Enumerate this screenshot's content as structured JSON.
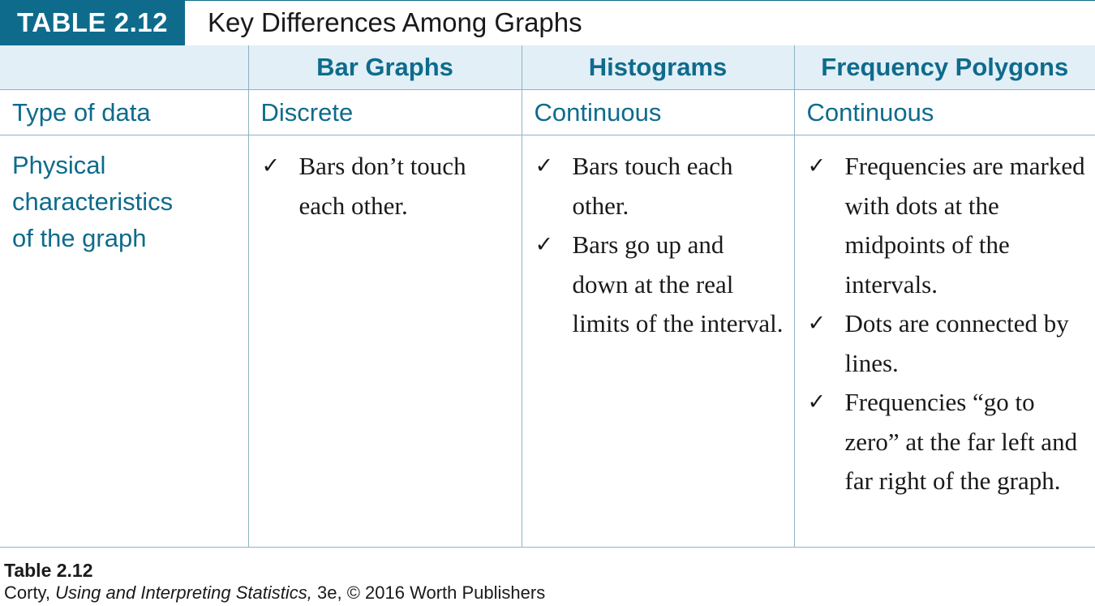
{
  "table": {
    "number": "TABLE 2.12",
    "title": "Key Differences Among Graphs",
    "columns": [
      "",
      "Bar Graphs",
      "Histograms",
      "Frequency Polygons"
    ],
    "rows": [
      {
        "label": "Type of data",
        "cells": [
          "Discrete",
          "Continuous",
          "Continuous"
        ]
      }
    ],
    "physical": {
      "label": "Physical\ncharacteristics\nof the graph",
      "bar_graphs": [
        "Bars don’t touch each other."
      ],
      "histograms": [
        "Bars touch each other.",
        "Bars go up and down at the real limits of the interval."
      ],
      "frequency_polygons": [
        "Frequencies are marked with dots at the midpoints of the intervals.",
        "Dots are connected by lines.",
        "Frequencies “go to zero” at the far left and far right of the graph."
      ]
    },
    "check_glyph": "✓"
  },
  "caption": {
    "title": "Table 2.12",
    "author": "Corty,",
    "book": "Using and Interpreting Statistics,",
    "rest": "3e, © 2016 Worth Publishers"
  },
  "colors": {
    "accent": "#0e6b8c",
    "header_bg": "#e2eff6",
    "rule": "#8fb3c4"
  }
}
